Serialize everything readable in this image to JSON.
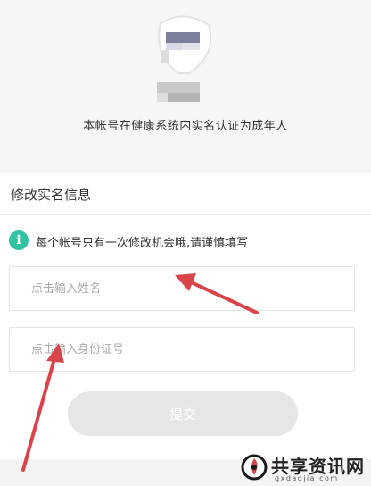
{
  "status": {
    "message": "本帐号在健康系统内实名认证为成年人"
  },
  "form": {
    "title": "修改实名信息",
    "notice": "每个帐号只有一次修改机会哦,请谨慎填写",
    "name_placeholder": "点击输入姓名",
    "id_placeholder": "点击输入身份证号",
    "submit_label": "提交"
  },
  "watermark": {
    "title": "共享资讯网",
    "url": "gxdaojia.com"
  },
  "colors": {
    "accent": "#2fc3a4",
    "arrow": "#d9434a",
    "submit_disabled": "#e6e6e6"
  }
}
